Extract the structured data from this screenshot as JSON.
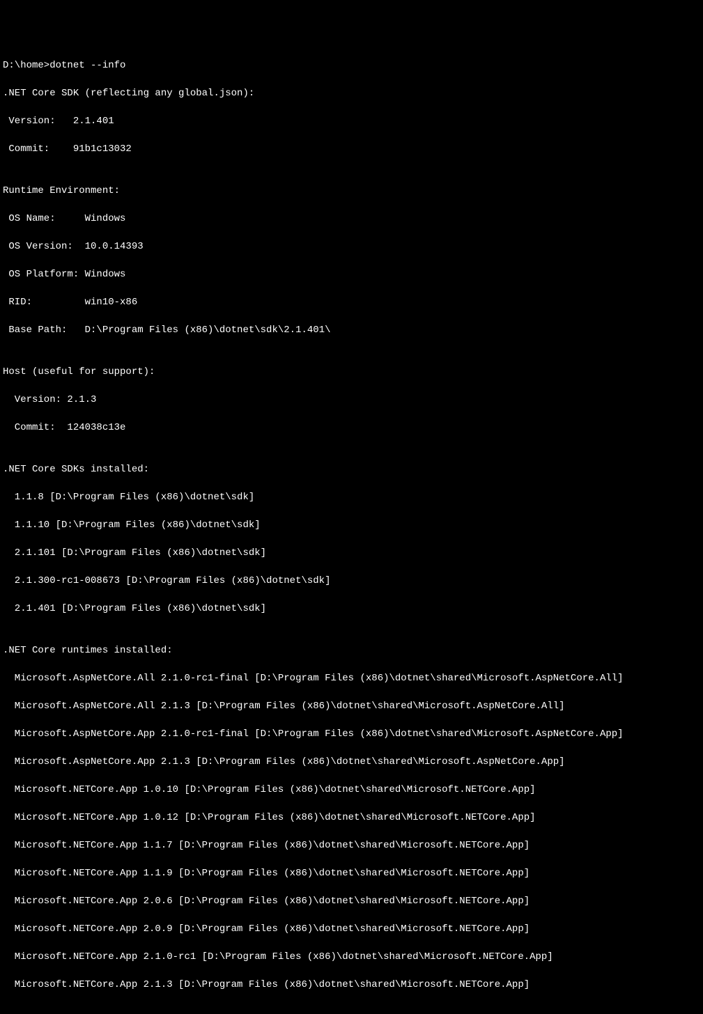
{
  "prompt": "D:\\home>dotnet --info",
  "sdk_header": ".NET Core SDK (reflecting any global.json):",
  "sdk_version_line": " Version:   2.1.401",
  "sdk_commit_line": " Commit:    91b1c13032",
  "blank": "",
  "runtime_env_header": "Runtime Environment:",
  "os_name_line": " OS Name:     Windows",
  "os_version_line": " OS Version:  10.0.14393",
  "os_platform_line": " OS Platform: Windows",
  "rid_line": " RID:         win10-x86",
  "base_path_line": " Base Path:   D:\\Program Files (x86)\\dotnet\\sdk\\2.1.401\\",
  "host_header": "Host (useful for support):",
  "host_version_line": "  Version: 2.1.3",
  "host_commit_line": "  Commit:  124038c13e",
  "sdks_header": ".NET Core SDKs installed:",
  "sdk1": "  1.1.8 [D:\\Program Files (x86)\\dotnet\\sdk]",
  "sdk2": "  1.1.10 [D:\\Program Files (x86)\\dotnet\\sdk]",
  "sdk3": "  2.1.101 [D:\\Program Files (x86)\\dotnet\\sdk]",
  "sdk4": "  2.1.300-rc1-008673 [D:\\Program Files (x86)\\dotnet\\sdk]",
  "sdk5": "  2.1.401 [D:\\Program Files (x86)\\dotnet\\sdk]",
  "runtimes_header": ".NET Core runtimes installed:",
  "rt1": "  Microsoft.AspNetCore.All 2.1.0-rc1-final [D:\\Program Files (x86)\\dotnet\\shared\\Microsoft.AspNetCore.All]",
  "rt2": "  Microsoft.AspNetCore.All 2.1.3 [D:\\Program Files (x86)\\dotnet\\shared\\Microsoft.AspNetCore.All]",
  "rt3": "  Microsoft.AspNetCore.App 2.1.0-rc1-final [D:\\Program Files (x86)\\dotnet\\shared\\Microsoft.AspNetCore.App]",
  "rt4": "  Microsoft.AspNetCore.App 2.1.3 [D:\\Program Files (x86)\\dotnet\\shared\\Microsoft.AspNetCore.App]",
  "rt5": "  Microsoft.NETCore.App 1.0.10 [D:\\Program Files (x86)\\dotnet\\shared\\Microsoft.NETCore.App]",
  "rt6": "  Microsoft.NETCore.App 1.0.12 [D:\\Program Files (x86)\\dotnet\\shared\\Microsoft.NETCore.App]",
  "rt7": "  Microsoft.NETCore.App 1.1.7 [D:\\Program Files (x86)\\dotnet\\shared\\Microsoft.NETCore.App]",
  "rt8": "  Microsoft.NETCore.App 1.1.9 [D:\\Program Files (x86)\\dotnet\\shared\\Microsoft.NETCore.App]",
  "rt9": "  Microsoft.NETCore.App 2.0.6 [D:\\Program Files (x86)\\dotnet\\shared\\Microsoft.NETCore.App]",
  "rt10": "  Microsoft.NETCore.App 2.0.9 [D:\\Program Files (x86)\\dotnet\\shared\\Microsoft.NETCore.App]",
  "rt11": "  Microsoft.NETCore.App 2.1.0-rc1 [D:\\Program Files (x86)\\dotnet\\shared\\Microsoft.NETCore.App]",
  "rt12": "  Microsoft.NETCore.App 2.1.3 [D:\\Program Files (x86)\\dotnet\\shared\\Microsoft.NETCore.App]"
}
